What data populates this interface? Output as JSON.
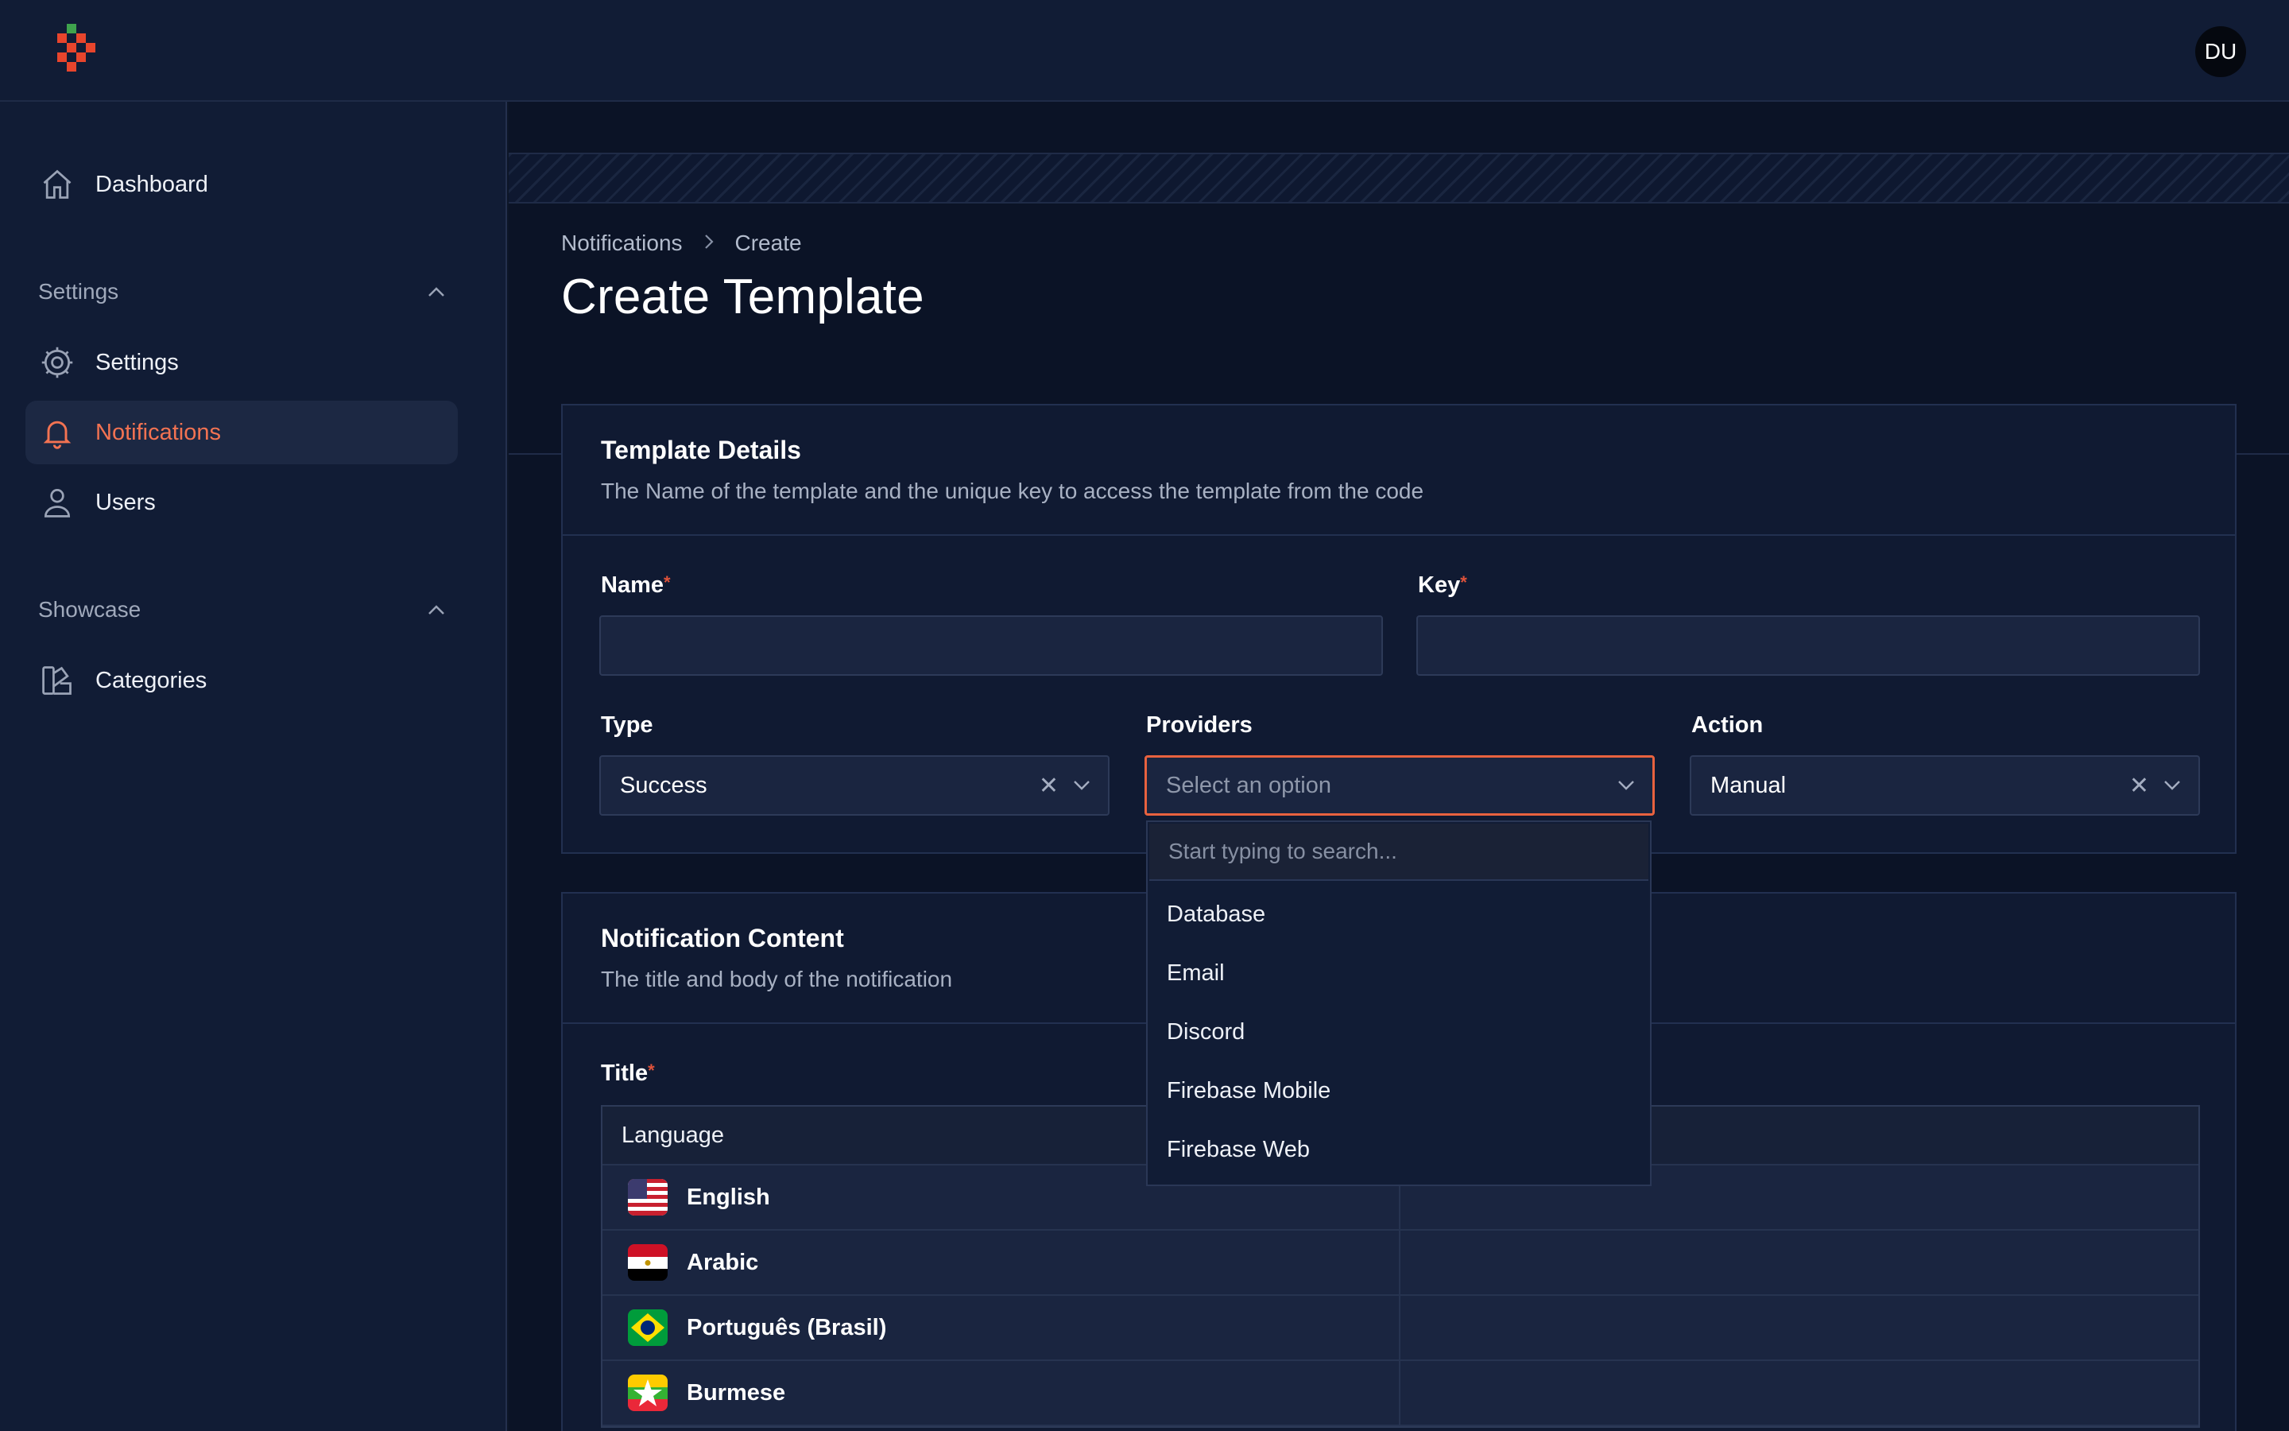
{
  "app": {
    "user_initials": "DU"
  },
  "sidebar": {
    "dashboard": "Dashboard",
    "groups": [
      {
        "label": "Settings",
        "items": [
          "Settings",
          "Notifications",
          "Users"
        ]
      },
      {
        "label": "Showcase",
        "items": [
          "Categories"
        ]
      }
    ],
    "active_item": "Notifications"
  },
  "breadcrumb": {
    "parent": "Notifications",
    "current": "Create"
  },
  "page": {
    "title": "Create Template"
  },
  "template_details": {
    "title": "Template Details",
    "description": "The Name of the template and the unique key to access the template from the code",
    "name_label": "Name",
    "name_value": "",
    "key_label": "Key",
    "key_value": "",
    "type_label": "Type",
    "type_value": "Success",
    "providers_label": "Providers",
    "providers_placeholder": "Select an option",
    "action_label": "Action",
    "action_value": "Manual",
    "required_mark": "*"
  },
  "providers_dropdown": {
    "search_placeholder": "Start typing to search...",
    "options": [
      "Database",
      "Email",
      "Discord",
      "Firebase Mobile",
      "Firebase Web"
    ]
  },
  "notification_content": {
    "title": "Notification Content",
    "description": "The title and body of the notification",
    "title_label": "Title",
    "table_header": "Language",
    "languages": [
      "English",
      "Arabic",
      "Português (Brasil)",
      "Burmese"
    ]
  },
  "colors": {
    "accent": "#f37352",
    "focus_border": "#e8623f",
    "background": "#0d1628"
  }
}
